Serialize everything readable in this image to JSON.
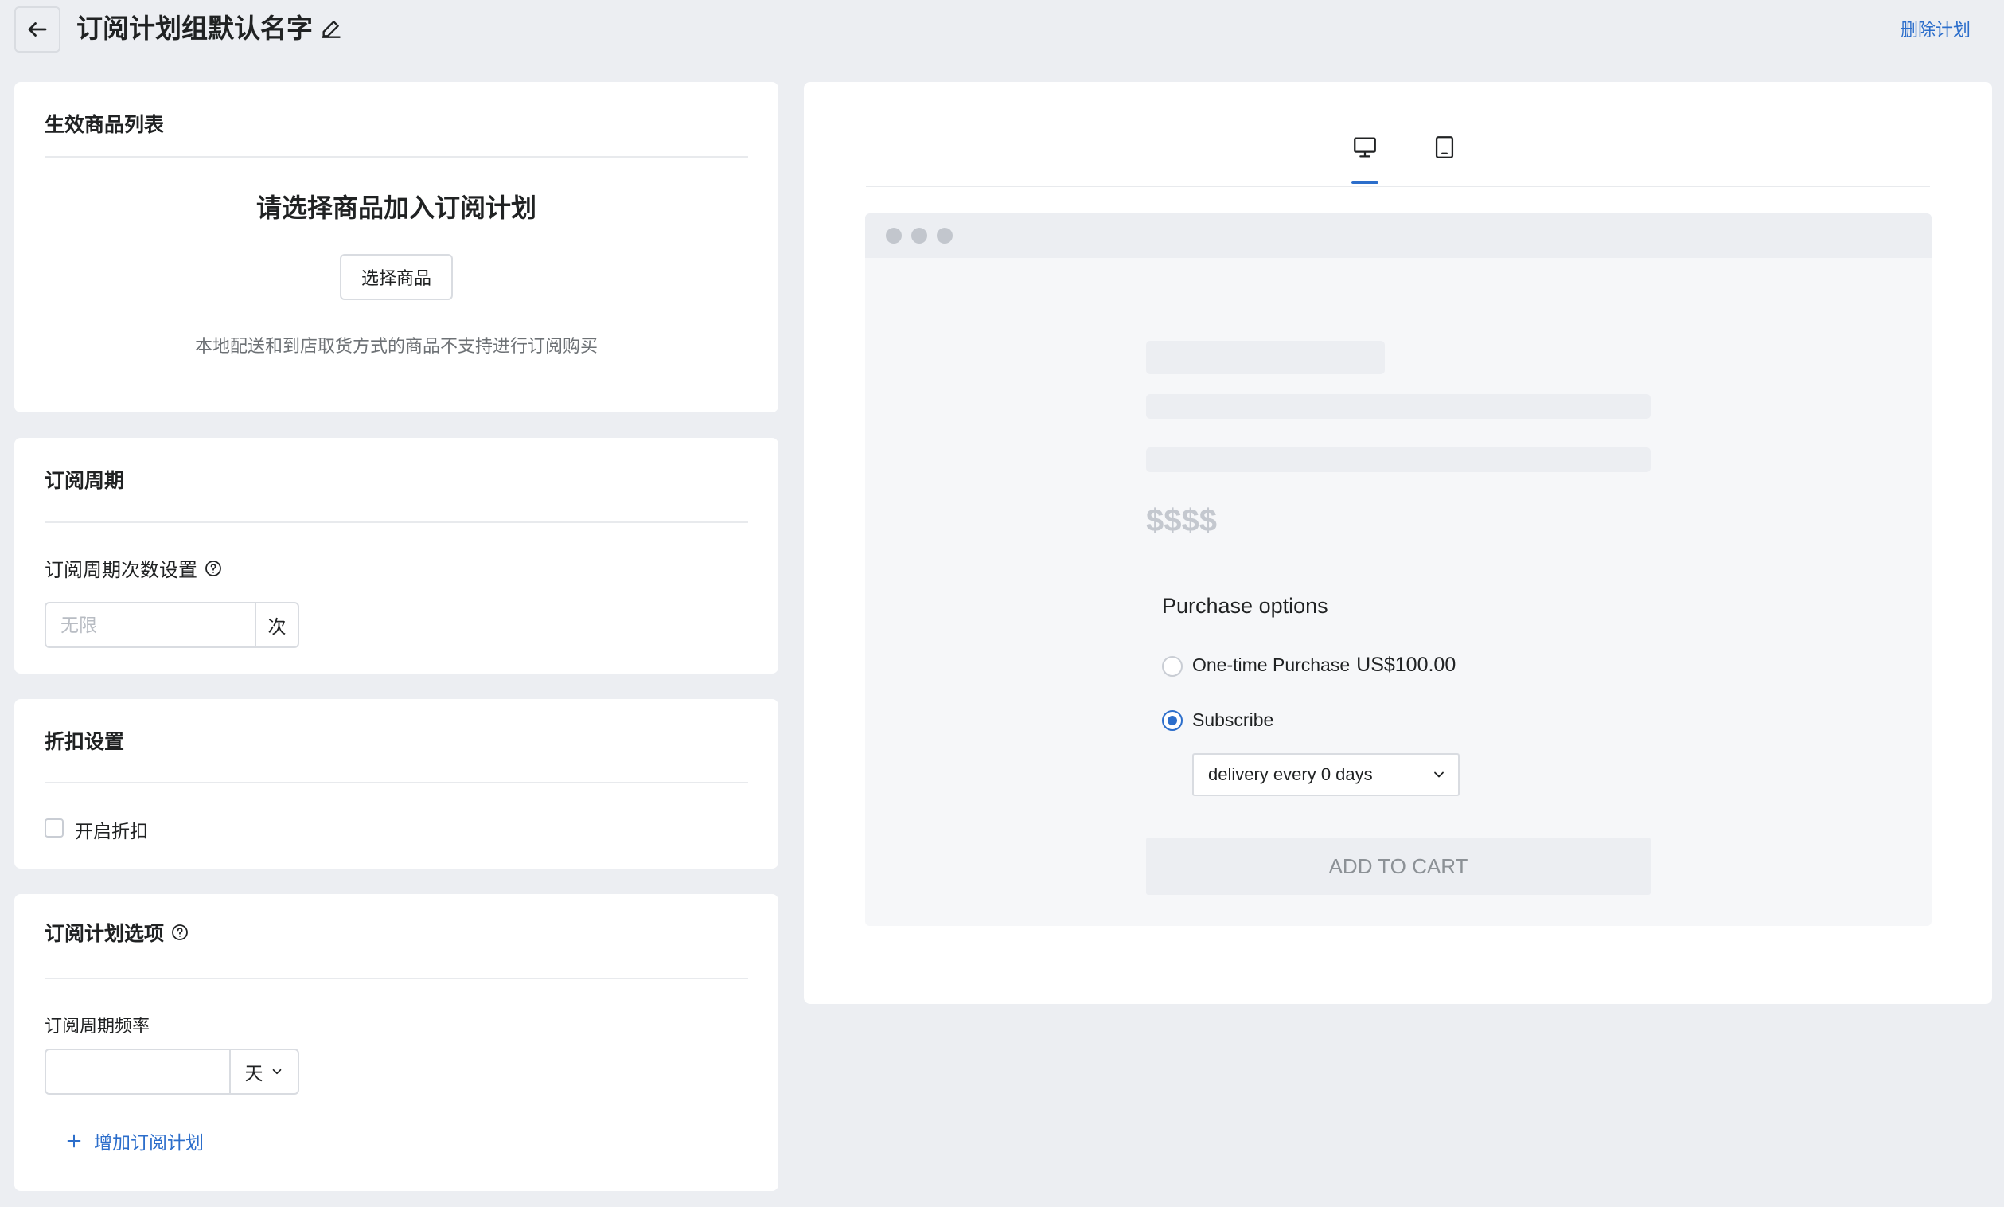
{
  "header": {
    "title": "订阅计划组默认名字",
    "delete_label": "删除计划"
  },
  "products_card": {
    "title": "生效商品列表",
    "empty_heading": "请选择商品加入订阅计划",
    "select_button": "选择商品",
    "note": "本地配送和到店取货方式的商品不支持进行订阅购买"
  },
  "cycle_card": {
    "title": "订阅周期",
    "field_label": "订阅周期次数设置",
    "input_placeholder": "无限",
    "input_value": "",
    "unit": "次"
  },
  "discount_card": {
    "title": "折扣设置",
    "checkbox_label": "开启折扣",
    "checked": false
  },
  "options_card": {
    "title": "订阅计划选项",
    "field_label": "订阅周期频率",
    "input_value": "",
    "unit_selected": "天",
    "add_label": "增加订阅计划"
  },
  "preview": {
    "active_device": "desktop",
    "price_placeholder": "$$$$",
    "purchase_options_title": "Purchase options",
    "one_time_label": "One-time Purchase",
    "one_time_price": "US$100.00",
    "subscribe_label": "Subscribe",
    "selected_option": "subscribe",
    "delivery_selected": "delivery every 0 days",
    "add_to_cart_label": "ADD TO CART"
  },
  "colors": {
    "accent": "#2c6ecb",
    "page_bg": "#eceef2",
    "card_bg": "#ffffff"
  }
}
